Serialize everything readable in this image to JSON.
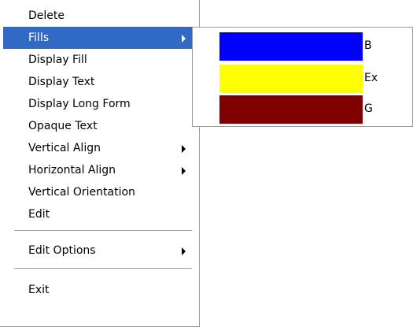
{
  "context_menu": {
    "items": [
      {
        "label": "Delete"
      },
      {
        "label": "Fills",
        "submenu": true,
        "selected": true
      },
      {
        "label": "Display Fill"
      },
      {
        "label": "Display Text"
      },
      {
        "label": "Display Long Form"
      },
      {
        "label": "Opaque Text"
      },
      {
        "label": "Vertical Align",
        "submenu": true
      },
      {
        "label": "Horizontal Align",
        "submenu": true
      },
      {
        "label": "Vertical Orientation"
      },
      {
        "label": "Edit"
      },
      {
        "label": "Edit Options",
        "submenu": true
      },
      {
        "label": "Exit"
      }
    ]
  },
  "fills_submenu": {
    "items": [
      {
        "label": "B",
        "color": "#0000ff"
      },
      {
        "label": "Ex",
        "color": "#ffff00"
      },
      {
        "label": "G",
        "color": "#800000"
      }
    ]
  },
  "colors": {
    "selection": "#316ac5",
    "menu_background": "#ffffff",
    "border": "#9a9a9a"
  }
}
